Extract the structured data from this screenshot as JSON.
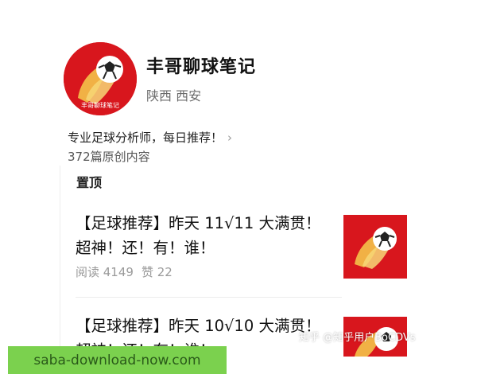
{
  "profile": {
    "name": "丰哥聊球笔记",
    "location": "陕西 西安",
    "logo_text": "丰哥聊球笔记",
    "bio": "专业足球分析师，每日推荐！",
    "article_count": "372篇原创内容"
  },
  "pinned": {
    "label": "置顶"
  },
  "articles": [
    {
      "title": "【足球推荐】昨天 11√11 大满贯！超神！还！有！谁！",
      "reads": "阅读 4149",
      "likes": "赞 22"
    },
    {
      "title": "【足球推荐】昨天 10√10 大满贯！超神！还！有！谁！"
    }
  ],
  "watermark": "知乎 @知乎用户BoCDVs",
  "ad_banner": {
    "text": "saba-download-now.com"
  },
  "colors": {
    "brand_red": "#d8161d",
    "banner_green": "#7bd14e",
    "muted_text": "#9a9a9a"
  }
}
